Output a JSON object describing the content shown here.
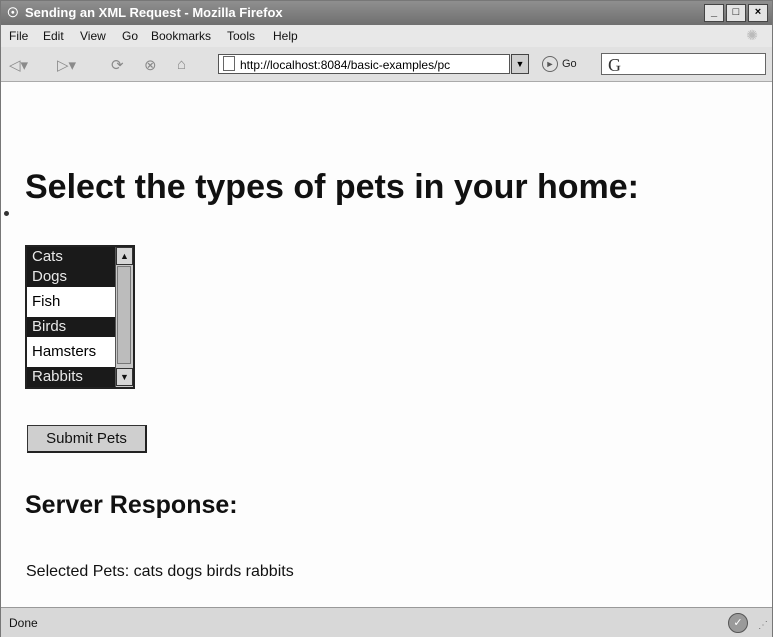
{
  "window": {
    "title": "Sending an XML Request - Mozilla Firefox",
    "controls": {
      "minimize": "_",
      "maximize": "□",
      "close": "×"
    }
  },
  "menubar": {
    "items": [
      "File",
      "Edit",
      "View",
      "Go",
      "Bookmarks",
      "Tools",
      "Help"
    ]
  },
  "navbar": {
    "url": "http://localhost:8084/basic-examples/pc",
    "go_label": "Go",
    "icons": [
      "back-icon",
      "forward-icon",
      "reload-icon",
      "stop-icon",
      "home-icon",
      "page-icon",
      "go-icon",
      "google-search-icon"
    ]
  },
  "page": {
    "heading": "Select the types of pets in your home:",
    "pets": [
      {
        "label": "Cats",
        "selected": true
      },
      {
        "label": "Dogs",
        "selected": true
      },
      {
        "label": "Fish",
        "selected": false
      },
      {
        "label": "Birds",
        "selected": true
      },
      {
        "label": "Hamsters",
        "selected": false
      },
      {
        "label": "Rabbits",
        "selected": true
      }
    ],
    "submit_label": "Submit Pets",
    "response_heading": "Server Response:",
    "response_text": "Selected Pets: cats dogs birds rabbits"
  },
  "statusbar": {
    "status": "Done"
  }
}
